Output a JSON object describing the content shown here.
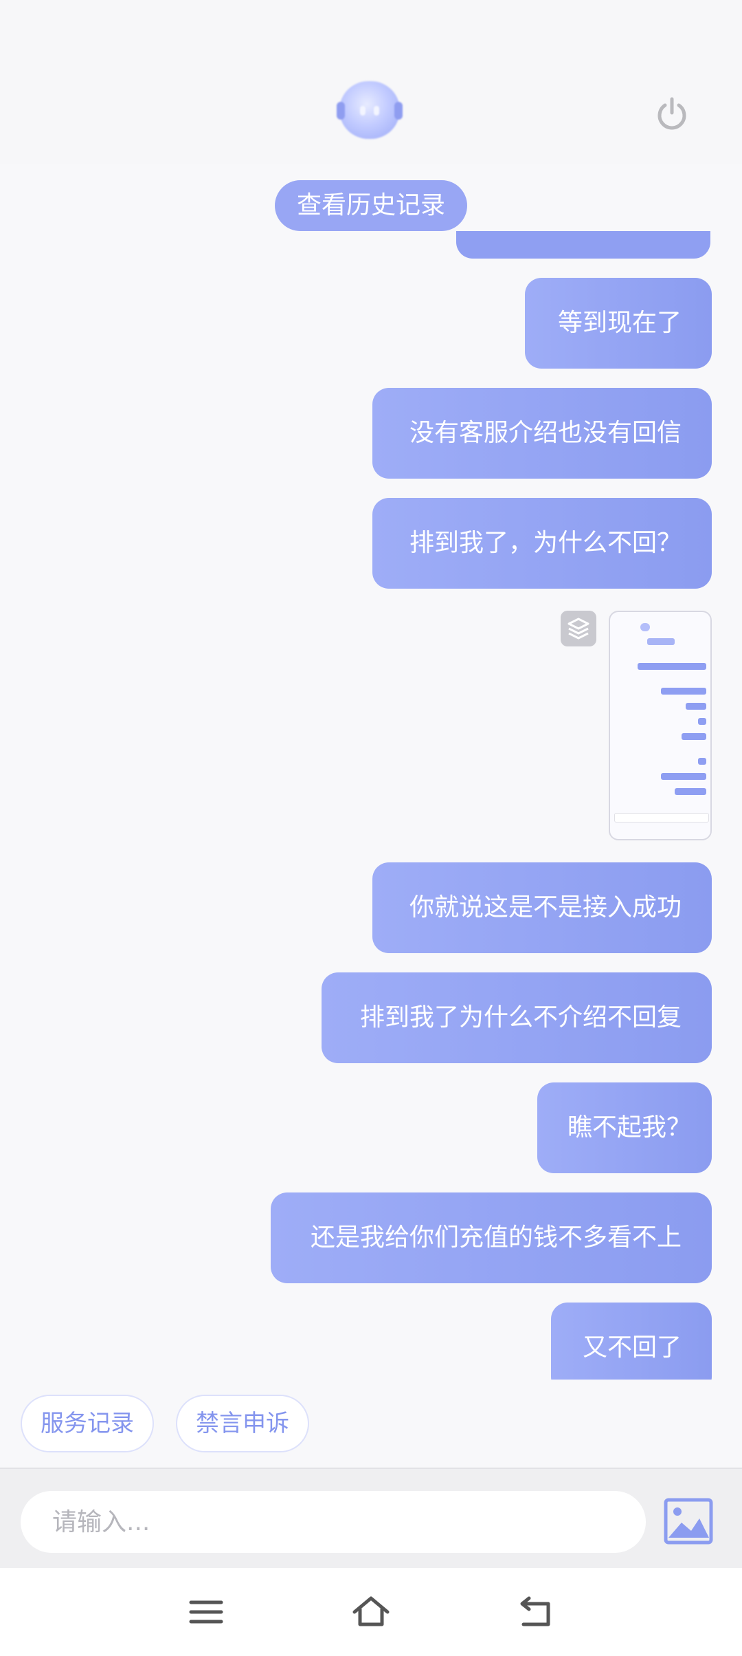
{
  "header": {
    "avatar_icon": "customer-service-robot-icon",
    "power_icon": "power-icon"
  },
  "history_button": "查看历史记录",
  "messages": [
    {
      "text": "等到现在了"
    },
    {
      "text": "没有客服介绍也没有回信"
    },
    {
      "text": "排到我了，为什么不回？"
    },
    {
      "type": "image",
      "icon": "layers-icon"
    },
    {
      "text": "你就说这是不是接入成功"
    },
    {
      "text": "排到我了为什么不介绍不回复"
    },
    {
      "text": "瞧不起我？"
    },
    {
      "text": "还是我给你们充值的钱不多看不上"
    },
    {
      "text": "又不回了"
    }
  ],
  "quick_actions": [
    "服务记录",
    "禁言申诉"
  ],
  "input": {
    "placeholder": "请输入..."
  },
  "image_button_icon": "image-icon",
  "nav": [
    "menu-icon",
    "home-icon",
    "back-icon"
  ],
  "colors": {
    "accent": "#8b9cf0",
    "bubble_start": "#9eadf7"
  }
}
